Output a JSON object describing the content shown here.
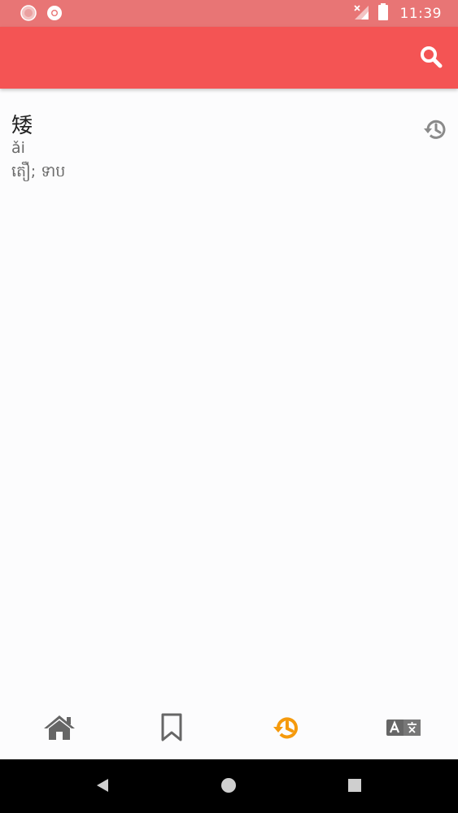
{
  "status_bar": {
    "time": "11:39",
    "icons": [
      "notification-icon",
      "chrome-icon",
      "no-signal-icon",
      "battery-icon"
    ]
  },
  "app_bar": {
    "search_icon": "search-icon",
    "color": "#f45454"
  },
  "history": {
    "items": [
      {
        "hanzi": "矮",
        "pinyin": "ǎi",
        "meaning": "តឿ; ទាប",
        "icon": "history-icon"
      }
    ]
  },
  "bottom_nav": {
    "items": [
      {
        "icon": "home-icon",
        "active": false
      },
      {
        "icon": "bookmark-icon",
        "active": false
      },
      {
        "icon": "history-icon",
        "active": true
      },
      {
        "icon": "translate-icon",
        "active": false
      }
    ],
    "active_color": "#f59a0c",
    "inactive_color": "#666666"
  },
  "system_nav": {
    "icons": [
      "back-icon",
      "home-circle-icon",
      "recents-icon"
    ]
  }
}
